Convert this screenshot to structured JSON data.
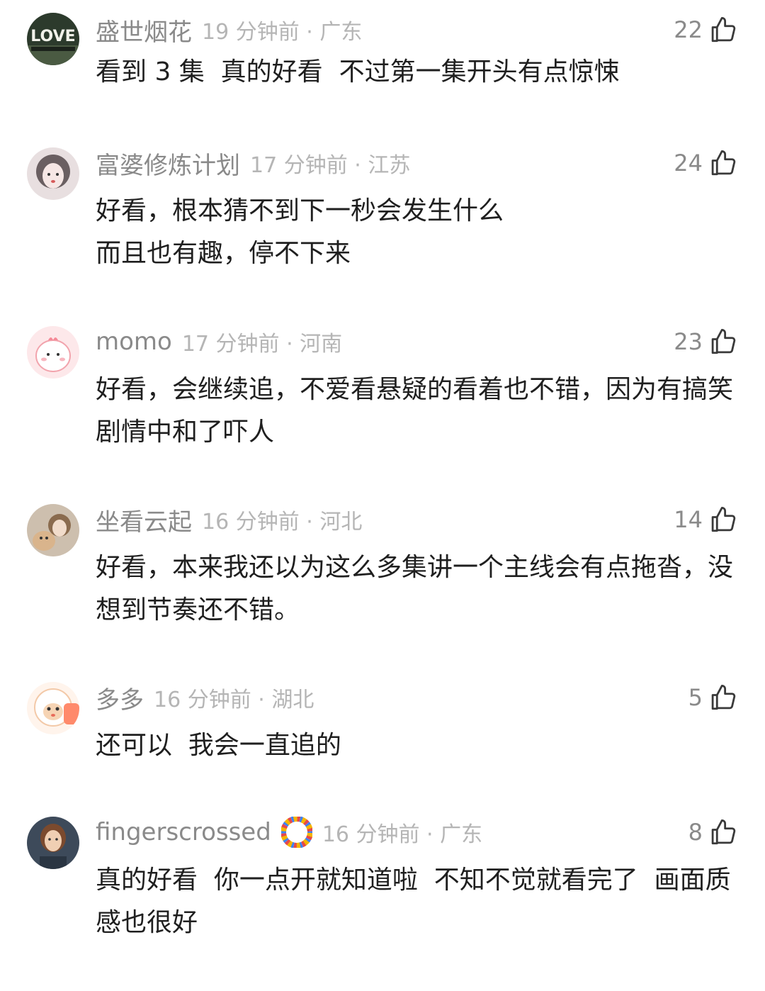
{
  "comments": [
    {
      "username": "盛世烟花",
      "time_location": "19 分钟前 · 广东",
      "likes": "22",
      "text": "看到 3 集  真的好看  不过第一集开头有点惊悚",
      "avatar_icon": "love-sign-avatar-icon",
      "avatar_text": "LOVE"
    },
    {
      "username": "富婆修炼计划",
      "time_location": "17 分钟前 · 江苏",
      "likes": "24",
      "text": "好看，根本猜不到下一秒会发生什么\n而且也有趣，停不下来",
      "avatar_icon": "girl-portrait-avatar-icon"
    },
    {
      "username": "momo",
      "time_location": "17 分钟前 · 河南",
      "likes": "23",
      "text": "好看，会继续追，不爱看悬疑的看着也不错，因为有搞笑剧情中和了吓人",
      "avatar_icon": "pink-chick-avatar-icon"
    },
    {
      "username": "坐看云起",
      "time_location": "16 分钟前 · 河北",
      "likes": "14",
      "text": "好看，本来我还以为这么多集讲一个主线会有点拖沓，没想到节奏还不错。",
      "avatar_icon": "girl-with-dog-avatar-icon"
    },
    {
      "username": "多多",
      "time_location": "16 分钟前 · 湖北",
      "likes": "5",
      "text": "还可以  我会一直追的",
      "avatar_icon": "cartoon-sheep-avatar-icon"
    },
    {
      "username": "fingerscrossed",
      "time_location": "16 分钟前 · 广东",
      "likes": "8",
      "text": "真的好看  你一点开就知道啦  不知不觉就看完了  画面质感也很好",
      "avatar_icon": "woman-portrait-avatar-icon",
      "badge_icon": "colorful-ring-badge-icon"
    }
  ],
  "colors": {
    "background": "#ffffff",
    "username": "#8a8a8a",
    "meta": "#b5b5b5",
    "text": "#1f1f1f"
  }
}
